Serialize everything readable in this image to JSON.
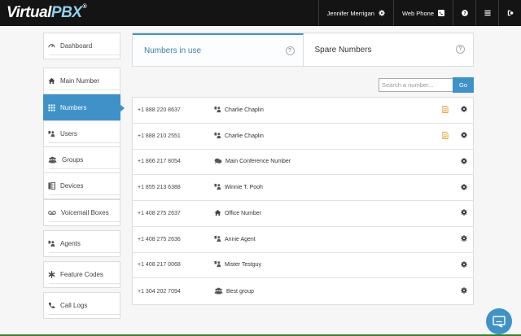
{
  "header": {
    "logo_text": "Virtual",
    "logo_accent": "PBX",
    "logo_mark": "®",
    "user_name": "Jennifer Merrigan",
    "web_phone": "Web Phone"
  },
  "sidebar": {
    "items": [
      {
        "label": "Dashboard",
        "icon": "gauge-icon"
      },
      {
        "label": "Main Number",
        "icon": "home-icon"
      },
      {
        "label": "Numbers",
        "icon": "grid-icon",
        "active": true
      },
      {
        "label": "Users",
        "icon": "users-icon"
      },
      {
        "label": "Groups",
        "icon": "group-icon"
      },
      {
        "label": "Devices",
        "icon": "devices-icon"
      },
      {
        "label": "Voicemail Boxes",
        "icon": "voicemail-icon"
      },
      {
        "label": "Agents",
        "icon": "agents-icon"
      },
      {
        "label": "Feature Codes",
        "icon": "asterisk-icon"
      },
      {
        "label": "Call Logs",
        "icon": "phone-icon"
      }
    ]
  },
  "tabs": [
    {
      "label": "Numbers in use",
      "active": true,
      "help": "?"
    },
    {
      "label": "Spare Numbers",
      "active": false,
      "help": "?"
    }
  ],
  "search": {
    "placeholder": "Search a number...",
    "button": "Go"
  },
  "numbers": [
    {
      "number": "+1 888 220 8637",
      "icon": "user-icon",
      "name": "Charlie Chaplin",
      "doc": true
    },
    {
      "number": "+1 888 210 2551",
      "icon": "user-icon",
      "name": "Charlie Chaplin",
      "doc": true
    },
    {
      "number": "+1 866 217 8054",
      "icon": "conference-icon",
      "name": "Main Conference Number",
      "doc": false
    },
    {
      "number": "+1 855 213 6388",
      "icon": "user-icon",
      "name": "Winnie T. Pooh",
      "doc": false
    },
    {
      "number": "+1 408 275 2637",
      "icon": "home-icon",
      "name": "Office Number",
      "doc": false
    },
    {
      "number": "+1 408 275 2636",
      "icon": "user-icon",
      "name": "Annie Agent",
      "doc": false
    },
    {
      "number": "+1 408 217 0068",
      "icon": "user-icon",
      "name": "Mister Testguy",
      "doc": false
    },
    {
      "number": "+1 304 202 7094",
      "icon": "group-icon",
      "name": "Best group",
      "doc": false
    }
  ],
  "colors": {
    "accent": "#3e92c8",
    "topbar": "#141414",
    "doc": "#e0a030"
  }
}
